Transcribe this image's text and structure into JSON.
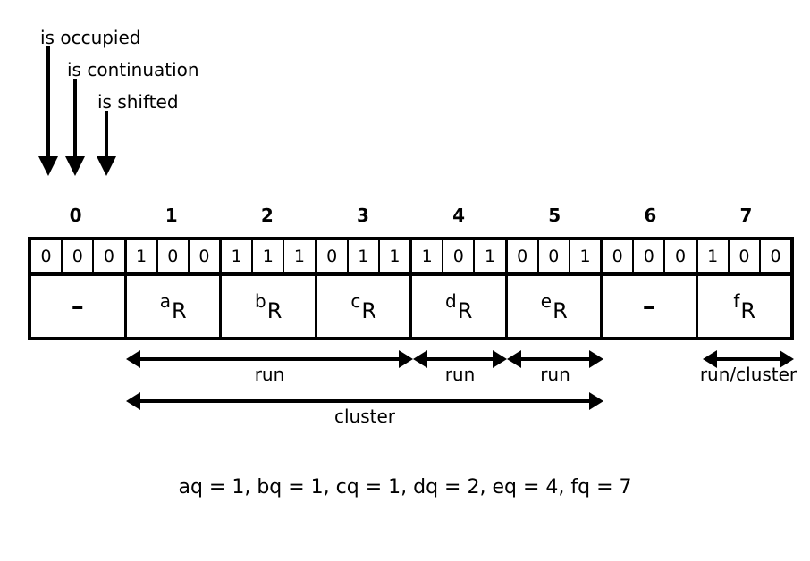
{
  "figure": {
    "annotations": [
      {
        "name": "is-occupied",
        "text": "is occupied"
      },
      {
        "name": "is-continuation",
        "text": "is continuation"
      },
      {
        "name": "is-shifted",
        "text": "is shifted"
      }
    ],
    "index_labels": [
      "0",
      "1",
      "2",
      "3",
      "4",
      "5",
      "6",
      "7"
    ],
    "bits": [
      "0",
      "0",
      "0",
      "1",
      "0",
      "0",
      "1",
      "1",
      "1",
      "0",
      "1",
      "1",
      "1",
      "0",
      "1",
      "0",
      "0",
      "1",
      "0",
      "0",
      "0",
      "1",
      "0",
      "0"
    ],
    "slots": [
      {
        "base": "–",
        "sub": "",
        "empty": true
      },
      {
        "base": "a",
        "sub": "R",
        "empty": false
      },
      {
        "base": "b",
        "sub": "R",
        "empty": false
      },
      {
        "base": "c",
        "sub": "R",
        "empty": false
      },
      {
        "base": "d",
        "sub": "R",
        "empty": false
      },
      {
        "base": "e",
        "sub": "R",
        "empty": false
      },
      {
        "base": "–",
        "sub": "",
        "empty": true
      },
      {
        "base": "f",
        "sub": "R",
        "empty": false
      }
    ],
    "measures": [
      {
        "name": "run-1",
        "label": "run"
      },
      {
        "name": "run-2",
        "label": "run"
      },
      {
        "name": "run-3",
        "label": "run"
      },
      {
        "name": "run-cluster",
        "label": "run/cluster"
      },
      {
        "name": "cluster",
        "label": "cluster"
      }
    ],
    "equation": "aq = 1, bq = 1, cq = 1, dq = 2, eq = 4, fq = 7",
    "colors": {
      "ink": "#000000",
      "paper": "#ffffff"
    }
  }
}
